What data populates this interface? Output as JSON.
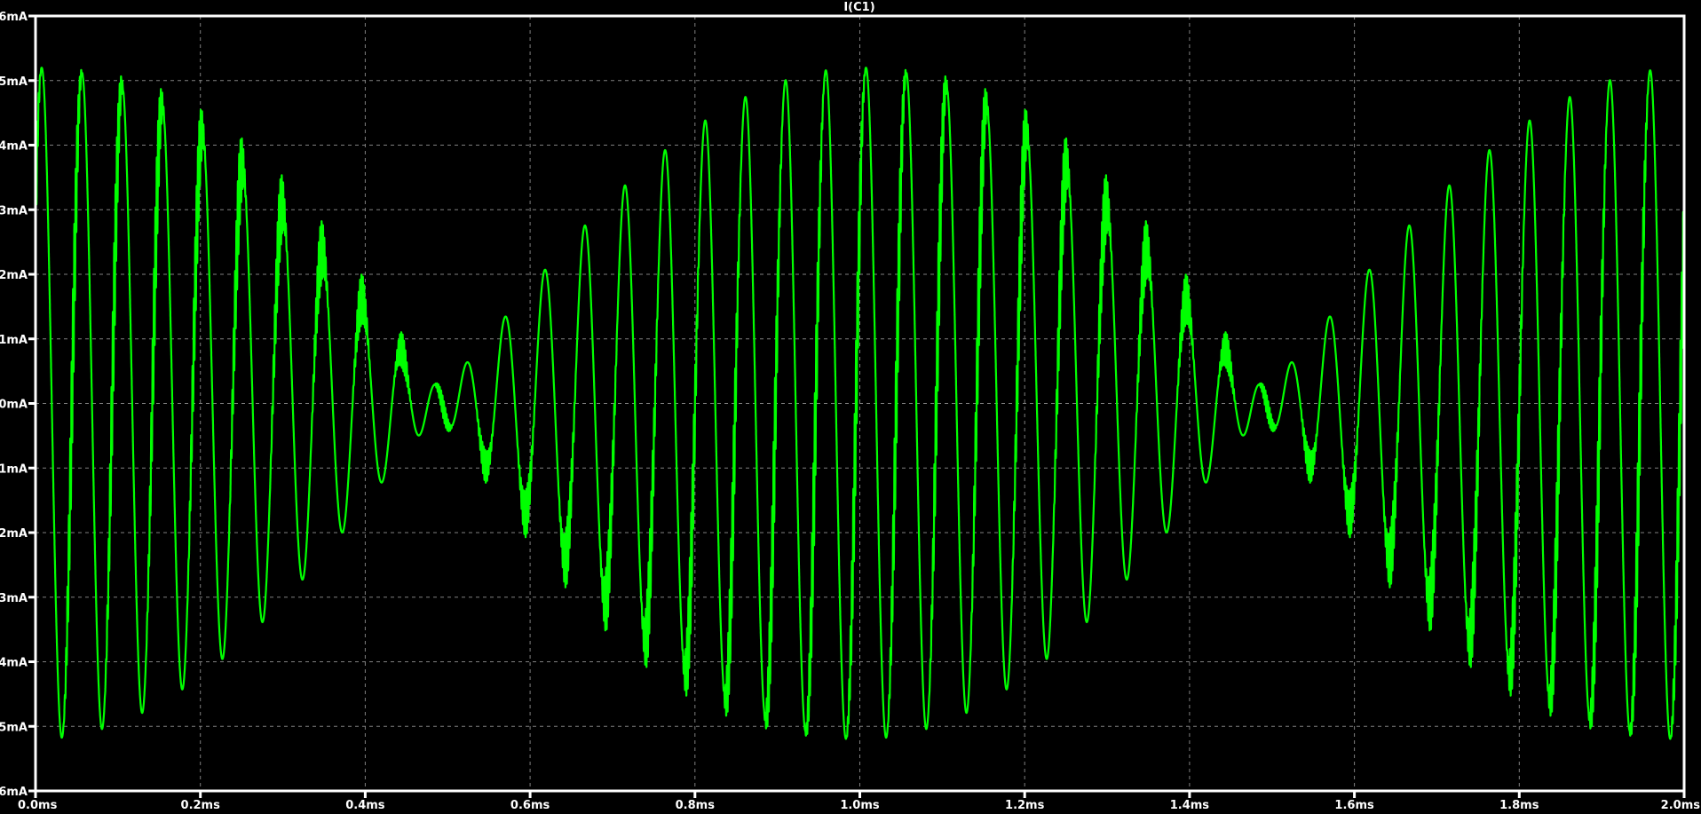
{
  "chart_data": {
    "type": "line",
    "title": "I(C1)",
    "xlabel": "",
    "ylabel": "",
    "xlim": [
      0,
      2.0
    ],
    "ylim": [
      -6,
      6
    ],
    "x_unit": "ms",
    "y_unit": "mA",
    "grid": true,
    "x_ticks": [
      "0.0ms",
      "0.2ms",
      "0.4ms",
      "0.6ms",
      "0.8ms",
      "1.0ms",
      "1.2ms",
      "1.4ms",
      "1.6ms",
      "1.8ms",
      "2.0ms"
    ],
    "y_ticks": [
      "6mA",
      "5mA",
      "4mA",
      "3mA",
      "2mA",
      "1mA",
      "0mA",
      "-1mA",
      "-2mA",
      "-3mA",
      "-4mA",
      "-5mA",
      "-6mA"
    ],
    "series": [
      {
        "name": "I(C1)",
        "color": "#00ff00",
        "description_model": {
          "carrier_freqs_khz": [
            20,
            21
          ],
          "peak_amplitude_ma": 5.2,
          "beat_period_ms": 1.0,
          "residual_at_null_ma": 0.35,
          "hf_ripple_khz": 600,
          "hf_ripple_amplitude_ma": 0.35
        },
        "envelope_peaks_ms": [
          0.0,
          1.0,
          2.0
        ],
        "envelope_nulls_ms": [
          0.5,
          1.5
        ]
      }
    ]
  },
  "colors": {
    "background": "#000000",
    "axis": "#ffffff",
    "grid": "#808080",
    "trace": "#00ff00"
  }
}
